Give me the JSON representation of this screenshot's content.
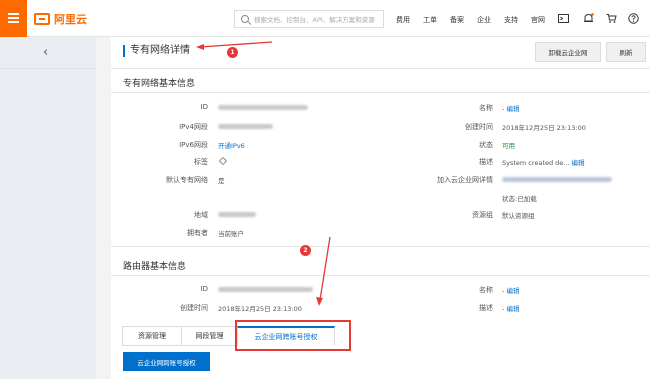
{
  "brand": {
    "logo_text": "阿里云",
    "accent": "#ff6a00",
    "link_color": "#0070cc"
  },
  "search": {
    "placeholder": "搜索文档、控制台、API、解决方案和资源"
  },
  "topnav": [
    "费用",
    "工单",
    "备案",
    "企业",
    "支持",
    "官网"
  ],
  "topnav_icons": [
    "terminal-icon",
    "bell-icon",
    "cart-icon",
    "help-icon"
  ],
  "page": {
    "title": "专有网络详情",
    "detach_btn": "卸载云企业网",
    "refresh_btn": "刷新"
  },
  "vpc_section": {
    "title": "专有网络基本信息",
    "left": [
      {
        "label": "ID",
        "value": ""
      },
      {
        "label": "IPv4网段",
        "value": ""
      },
      {
        "label": "IPv6网段",
        "value": "开通IPv6"
      },
      {
        "label": "标签",
        "value": ""
      },
      {
        "label": "默认专有网络",
        "value": "是"
      },
      {
        "label": "地域",
        "value": ""
      },
      {
        "label": "拥有者",
        "value": "当前账户"
      }
    ],
    "right": [
      {
        "label": "名称",
        "value": "-",
        "link": "编辑"
      },
      {
        "label": "创建时间",
        "value": "2018年12月25日 23:13:00"
      },
      {
        "label": "状态",
        "value": "可用"
      },
      {
        "label": "描述",
        "value": "System created de...",
        "link": "编辑"
      },
      {
        "label": "加入云企业网详情",
        "value": "",
        "extra": "状态:已加载"
      },
      {
        "label": "资源组",
        "value": "默认资源组"
      }
    ]
  },
  "router_section": {
    "title": "路由器基本信息",
    "left": [
      {
        "label": "ID",
        "value": ""
      },
      {
        "label": "创建时间",
        "value": "2018年12月25日 23:13:00"
      }
    ],
    "right": [
      {
        "label": "名称",
        "value": "-",
        "link": "编辑"
      },
      {
        "label": "描述",
        "value": "-",
        "link": "编辑"
      }
    ]
  },
  "tabs": [
    "资源管理",
    "网段管理",
    "云企业网跨账号授权"
  ],
  "primary_btn": "云企业网跨账号授权",
  "annotations": [
    "1",
    "2"
  ]
}
